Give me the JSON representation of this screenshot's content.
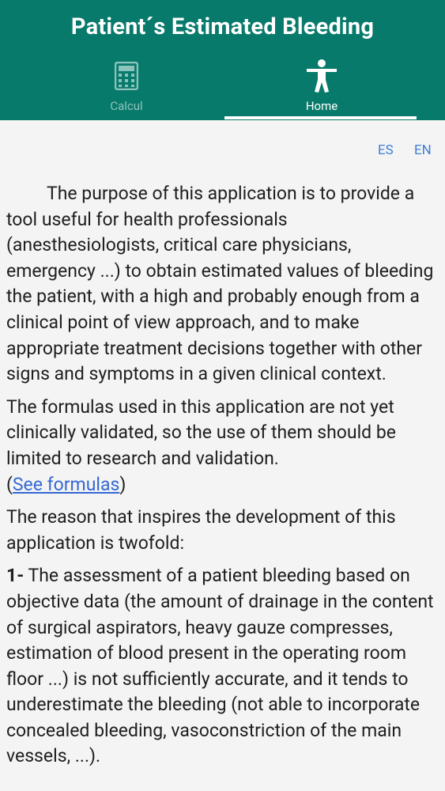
{
  "app": {
    "title": "Patient´s Estimated Bleeding",
    "accent_color": "#087a6b"
  },
  "tabs": [
    {
      "label": "Calcul",
      "icon": "calculator-icon",
      "selected": false
    },
    {
      "label": "Home",
      "icon": "person-accessibility-icon",
      "selected": true
    }
  ],
  "language": {
    "es": "ES",
    "en": "EN"
  },
  "content": {
    "p1": "The purpose of this application is to provide a tool useful for health professionals (anesthesiologists, critical care physicians, emergency ...) to obtain estimated values of bleeding the patient, with a high and probably enough from a clinical point of view approach, and to make appropriate treatment decisions together with other signs and symptoms in a given clinical context.",
    "p2_text": "The formulas used in this application are not yet clinically validated, so the use of them should be limited to research and validation.",
    "p2_open": "(",
    "p2_link": "See formulas",
    "p2_close": ")",
    "p3": "The reason that inspires the development of this application is twofold:",
    "p4_num": "1-",
    "p4_text": "The assessment of a patient bleeding based on objective data (the amount of drainage in the content of surgical aspirators, heavy gauze compresses, estimation of blood present in the operating room floor ...) is not sufficiently accurate, and it tends to underestimate the bleeding (not able to incorporate concealed bleeding, vasoconstriction of the main vessels, ...)."
  }
}
